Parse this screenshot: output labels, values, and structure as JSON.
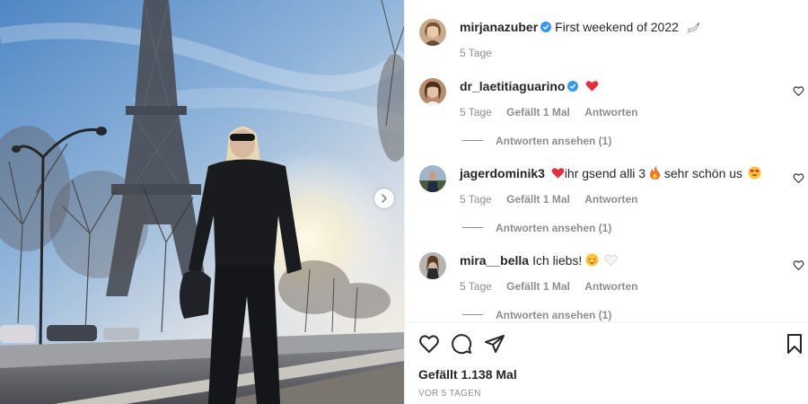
{
  "post": {
    "author": "mirjanazuber",
    "caption": "First weekend of 2022",
    "caption_emoji": "dove",
    "time": "5 Tage"
  },
  "comments": [
    {
      "user": "dr_laetitiaguarino",
      "verified": true,
      "text": "",
      "emojis": [
        "red-heart"
      ],
      "time": "5 Tage",
      "likes": "Gefällt 1 Mal",
      "reply_label": "Antworten",
      "view_replies": "Antworten ansehen (1)"
    },
    {
      "user": "jagerdominik3",
      "verified": false,
      "text_parts": [
        "ihr gsend alli 3",
        " sehr schön us"
      ],
      "emojis": [
        "red-heart",
        "fire",
        "heart-eyes"
      ],
      "time": "5 Tage",
      "likes": "Gefällt 1 Mal",
      "reply_label": "Antworten",
      "view_replies": "Antworten ansehen (1)"
    },
    {
      "user": "mira__bella",
      "verified": false,
      "text": "Ich liebs!",
      "emojis": [
        "smiling-face",
        "white-heart"
      ],
      "time": "5 Tage",
      "likes": "Gefällt 1 Mal",
      "reply_label": "Antworten",
      "view_replies": "Antworten ansehen (1)"
    }
  ],
  "footer": {
    "likes": "Gefällt 1.138 Mal",
    "posted_ago": "VOR 5 TAGEN"
  },
  "colors": {
    "text": "#262626",
    "muted": "#8e8e8e",
    "verified": "#3897f0",
    "heart": "#ed4956",
    "divider": "#efefef"
  },
  "icons": [
    "like-icon",
    "comment-icon",
    "share-icon",
    "save-icon",
    "verified-icon",
    "next-arrow-icon"
  ]
}
